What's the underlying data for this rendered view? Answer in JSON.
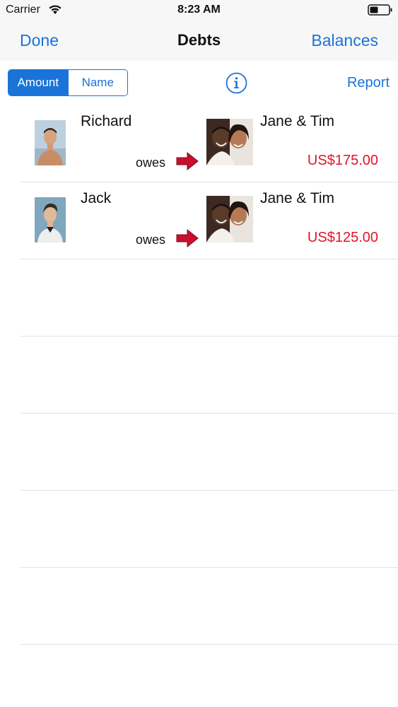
{
  "status_bar": {
    "carrier": "Carrier",
    "time": "8:23 AM"
  },
  "nav": {
    "left_label": "Done",
    "title": "Debts",
    "right_label": "Balances"
  },
  "toolbar": {
    "segments": [
      "Amount",
      "Name"
    ],
    "selected_segment": "Amount",
    "report_label": "Report"
  },
  "debts": [
    {
      "from": "Richard",
      "verb": "owes",
      "to": "Jane & Tim",
      "amount": "US$175.00"
    },
    {
      "from": "Jack",
      "verb": "owes",
      "to": "Jane & Tim",
      "amount": "US$125.00"
    }
  ],
  "colors": {
    "accent": "#1a73d9",
    "amount": "#e0142a",
    "arrow": "#c8102e"
  }
}
